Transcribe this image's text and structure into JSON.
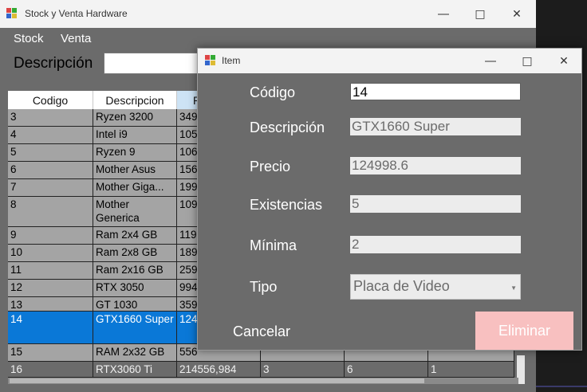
{
  "main_window": {
    "title": "Stock y Venta Hardware",
    "menu": [
      "Stock",
      "Venta"
    ],
    "search_label": "Descripción",
    "search_value": ""
  },
  "grid": {
    "columns": [
      "Codigo",
      "Descripcion",
      "P"
    ],
    "rows": [
      [
        "3",
        "Ryzen 3200",
        "349",
        "",
        "",
        ""
      ],
      [
        "4",
        "Intel i9",
        "105",
        "",
        "",
        ""
      ],
      [
        "5",
        "Ryzen 9",
        "106",
        "",
        "",
        ""
      ],
      [
        "6",
        "Mother Asus",
        "156",
        "",
        "",
        ""
      ],
      [
        "7",
        "Mother Giga...",
        "199",
        "",
        "",
        ""
      ],
      [
        "8",
        "Mother Generica",
        "109",
        "",
        "",
        ""
      ],
      [
        "9",
        "Ram 2x4 GB",
        "119",
        "",
        "",
        ""
      ],
      [
        "10",
        "Ram 2x8 GB",
        "189",
        "",
        "",
        ""
      ],
      [
        "11",
        "Ram 2x16 GB",
        "259",
        "",
        "",
        ""
      ],
      [
        "12",
        "RTX 3050",
        "994",
        "",
        "",
        ""
      ],
      [
        "13",
        "GT 1030",
        "359",
        "",
        "",
        ""
      ],
      [
        "14",
        "GTX1660 Super",
        "124",
        "",
        "",
        ""
      ],
      [
        "15",
        "RAM 2x32 GB",
        "556",
        "",
        "",
        ""
      ],
      [
        "16",
        "RTX3060 Ti",
        "214556,984",
        "3",
        "6",
        "1"
      ]
    ]
  },
  "dialog": {
    "title": "Item",
    "fields": {
      "codigo": {
        "label": "Código",
        "value": "14"
      },
      "descripcion": {
        "label": "Descripción",
        "value": "GTX1660 Super"
      },
      "precio": {
        "label": "Precio",
        "value": "124998.6"
      },
      "existencias": {
        "label": "Existencias",
        "value": "5"
      },
      "minima": {
        "label": "Mínima",
        "value": "2"
      },
      "tipo": {
        "label": "Tipo",
        "value": "Placa de Video"
      }
    },
    "cancel_label": "Cancelar",
    "delete_label": "Eliminar"
  },
  "colors": {
    "window_bg": "#6b6b6b",
    "selection": "#0a78d7",
    "delete_button": "#f8c0c0"
  }
}
